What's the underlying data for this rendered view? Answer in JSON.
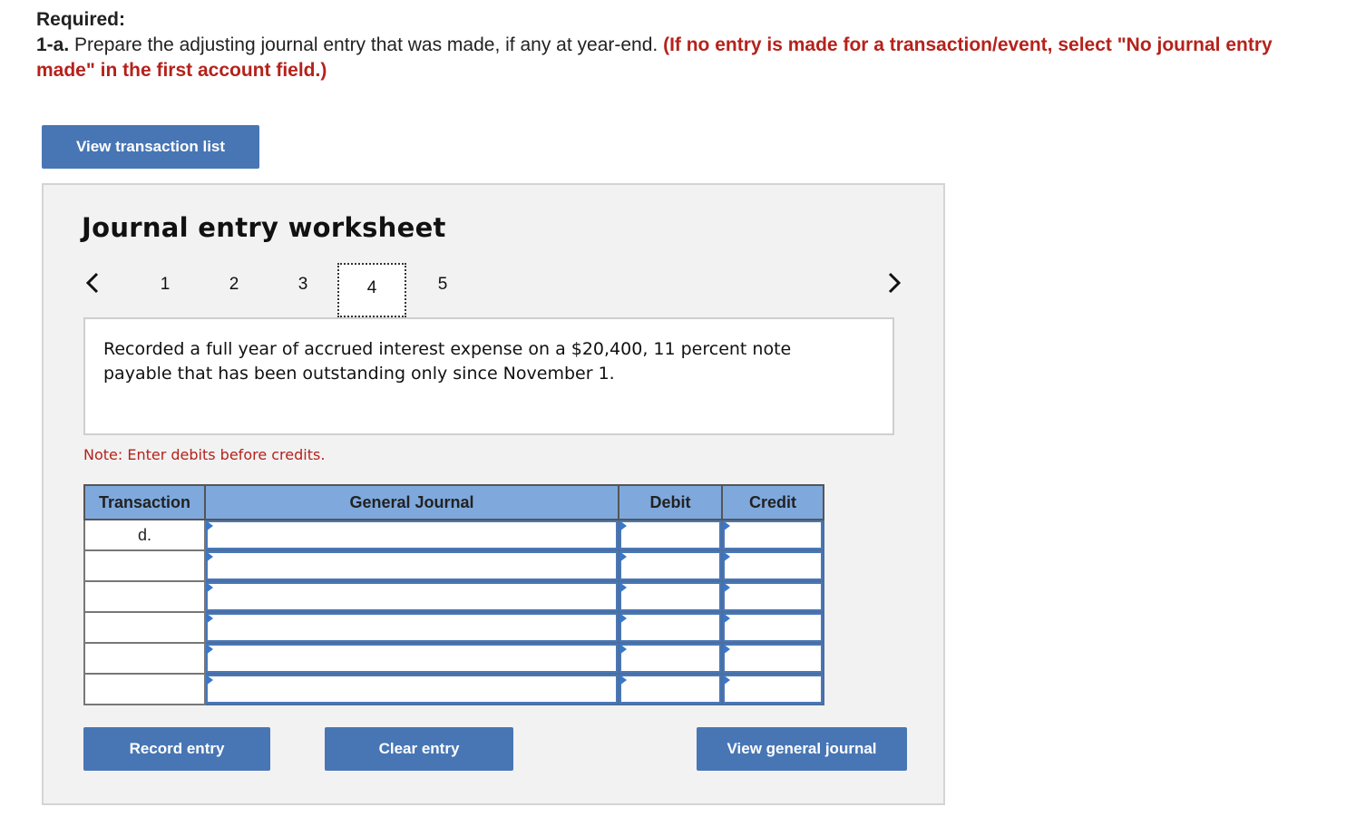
{
  "header": {
    "required_label": "Required:",
    "part_number": "1-a.",
    "instruction_text": "Prepare the adjusting journal entry that was made, if any at year-end.",
    "instruction_note": "(If no entry is made for a transaction/event, select \"No journal entry made\" in the first account field.)"
  },
  "buttons": {
    "view_transaction_list": "View transaction list",
    "record_entry": "Record entry",
    "clear_entry": "Clear entry",
    "view_general_journal": "View general journal"
  },
  "worksheet": {
    "title": "Journal entry worksheet",
    "steps": [
      "1",
      "2",
      "3",
      "4",
      "5"
    ],
    "active_step": "4",
    "description": "Recorded a full year of accrued interest expense on a $20,400, 11 percent note payable that has been outstanding only since November 1.",
    "note": "Note: Enter debits before credits."
  },
  "table": {
    "headers": [
      "Transaction",
      "General Journal",
      "Debit",
      "Credit"
    ],
    "rows": [
      {
        "transaction": "d."
      },
      {
        "transaction": ""
      },
      {
        "transaction": ""
      },
      {
        "transaction": ""
      },
      {
        "transaction": ""
      },
      {
        "transaction": ""
      }
    ]
  },
  "colors": {
    "button_bg": "#4876b4",
    "header_bg": "#7fa9dd",
    "note_red": "#b5221b"
  }
}
